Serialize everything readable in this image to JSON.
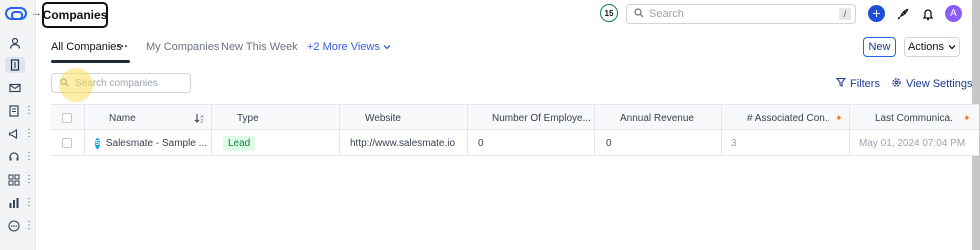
{
  "header": {
    "title": "Companies",
    "badge_count": "15",
    "search_placeholder": "Search",
    "search_shortcut": "/",
    "avatar_initial": "A"
  },
  "tabs": [
    {
      "label": "All Companies",
      "active": true
    },
    {
      "label": "My Companies",
      "active": false
    },
    {
      "label": "New This Week",
      "active": false
    }
  ],
  "tab_more_label": "···",
  "more_views_label": "+2 More Views",
  "buttons": {
    "new_label": "New",
    "actions_label": "Actions"
  },
  "toolbar": {
    "search_placeholder": "Search companies",
    "filters_label": "Filters",
    "view_settings_label": "View Settings"
  },
  "table": {
    "columns": [
      "Name",
      "Type",
      "Website",
      "Number Of Employe...",
      "Annual Revenue",
      "# Associated Con...",
      "Last Communica..."
    ],
    "rows": [
      {
        "name": "Salesmate - Sample ...",
        "logo_letter": "S",
        "type": "Lead",
        "website": "http://www.salesmate.io",
        "employees": "0",
        "revenue": "0",
        "associated": "3",
        "last_communication": "May 01, 2024 07:04 PM"
      }
    ]
  },
  "colors": {
    "accent": "#1d4ed8",
    "lead_badge_bg": "#dcfce7",
    "lead_badge_text": "#15803d",
    "avatar": "#8b5cf6"
  }
}
